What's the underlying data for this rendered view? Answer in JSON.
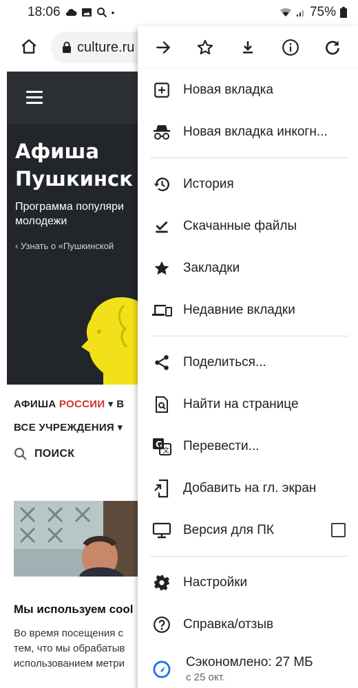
{
  "status_bar": {
    "time": "18:06",
    "battery": "75%",
    "dot": "•",
    "icons": [
      "cloud-icon",
      "image-icon",
      "search-icon",
      "wifi-icon",
      "signal-icon",
      "battery-icon"
    ]
  },
  "toolbar": {
    "url": "culture.ru",
    "icons": [
      "home-icon",
      "lock-icon"
    ]
  },
  "page": {
    "hero_title": "Афиша\nПушкинск",
    "hero_subtitle": "Программа популяри\nмолодежи",
    "hero_link": "‹  Узнать о «Пушкинской",
    "nav_afisha": "АФИША ",
    "nav_russia": "РОССИИ",
    "nav_caret": " ▾",
    "nav_extra": "   В",
    "nav_institutions": "ВСЕ УЧРЕЖДЕНИЯ ▾",
    "search_label": "ПОИСК",
    "cookie_title": "Мы используем cool",
    "cookie_text": "Во время посещения с\nтем, что мы обрабатыв\nиспользованием метри",
    "colors": {
      "hero_bg": "#22252a",
      "accent_red": "#d32f2f",
      "bust_yellow": "#f2e01a"
    }
  },
  "menu": {
    "actions": [
      {
        "name": "forward",
        "icon": "arrow-right-icon"
      },
      {
        "name": "bookmark",
        "icon": "star-outline-icon"
      },
      {
        "name": "download",
        "icon": "download-icon"
      },
      {
        "name": "page-info",
        "icon": "info-icon"
      },
      {
        "name": "refresh",
        "icon": "refresh-icon"
      }
    ],
    "items": {
      "new_tab": "Новая вкладка",
      "incognito": "Новая вкладка инкогн...",
      "history": "История",
      "downloads": "Скачанные файлы",
      "bookmarks": "Закладки",
      "recent_tabs": "Недавние вкладки",
      "share": "Поделиться...",
      "find": "Найти на странице",
      "translate": "Перевести...",
      "add_home": "Добавить на гл. экран",
      "desktop": "Версия для ПК",
      "settings": "Настройки",
      "help": "Справка/отзыв"
    },
    "desktop_checked": false,
    "saved": {
      "title": "Сэкономлено: 27 МБ",
      "since": "с 25 окт."
    }
  }
}
